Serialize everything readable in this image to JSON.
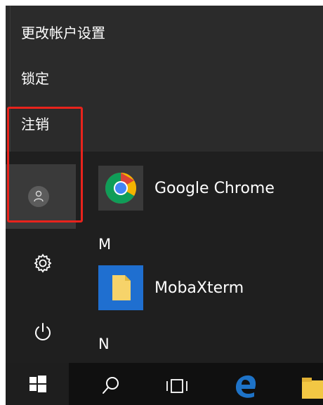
{
  "account_menu": {
    "items": [
      {
        "label": "更改帐户设置"
      },
      {
        "label": "锁定"
      },
      {
        "label": "注销"
      }
    ]
  },
  "left_rail": {
    "user_icon": "user-avatar-icon",
    "settings_icon": "gear-icon",
    "power_icon": "power-icon"
  },
  "app_list": {
    "items": [
      {
        "name": "Google Chrome",
        "icon": "chrome-icon"
      },
      {
        "header": "M"
      },
      {
        "name": "MobaXterm",
        "icon": "mobaxterm-icon"
      },
      {
        "header": "N"
      }
    ]
  },
  "taskbar": {
    "icons": [
      "windows-start-icon",
      "search-icon",
      "task-view-icon",
      "edge-icon",
      "file-explorer-icon"
    ]
  },
  "colors": {
    "highlight": "#e8231c",
    "menu_bg": "#2b2b2b",
    "start_bg": "#1f1f1f",
    "taskbar_bg": "#101010",
    "edge_blue": "#1e73c8"
  }
}
